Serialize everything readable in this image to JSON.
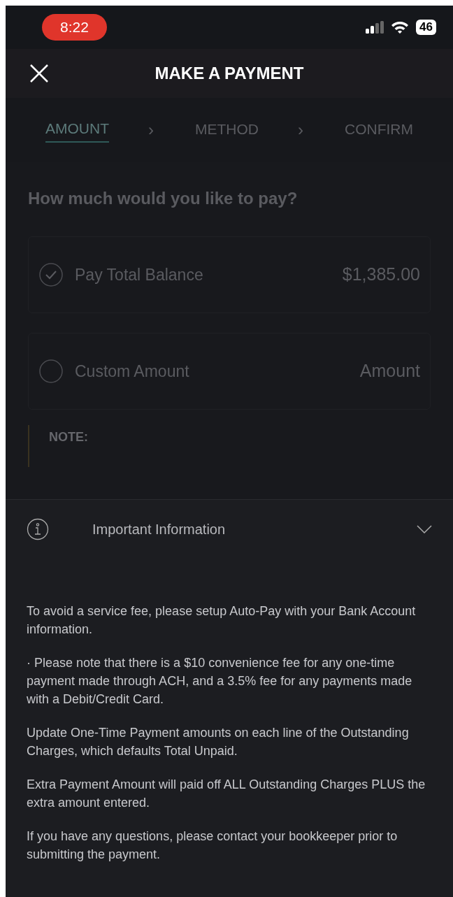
{
  "status_bar": {
    "time": "8:22",
    "battery": "46"
  },
  "header": {
    "title": "MAKE A PAYMENT"
  },
  "steps": [
    {
      "label": "AMOUNT",
      "selected": true,
      "separator": "›"
    },
    {
      "label": "METHOD",
      "selected": false,
      "separator": "›"
    },
    {
      "label": "CONFIRM",
      "selected": false
    }
  ],
  "question": "How much would you like to pay?",
  "options": [
    {
      "label": "Pay Total Balance",
      "value": "$1,385.00",
      "checked": true,
      "kind": "text"
    },
    {
      "label": "Custom Amount",
      "placeholder": "Amount",
      "checked": false,
      "kind": "input"
    }
  ],
  "note": {
    "title": "NOTE:"
  },
  "info_sheet": {
    "title": "Important Information",
    "expanded": true,
    "paragraphs": [
      "To avoid a service fee, please setup Auto-Pay with your Bank Account information.",
      "· Please note that there is a $10 convenience fee for any one-time payment made through ACH, and a 3.5% fee for any payments made with a Debit/Credit Card.",
      "Update One-Time Payment amounts on each line of the Outstanding Charges, which defaults Total Unpaid.",
      "Extra Payment Amount will paid off ALL Outstanding Charges PLUS the extra amount entered.",
      "If you have any questions, please contact your bookkeeper prior to submitting the payment."
    ]
  }
}
